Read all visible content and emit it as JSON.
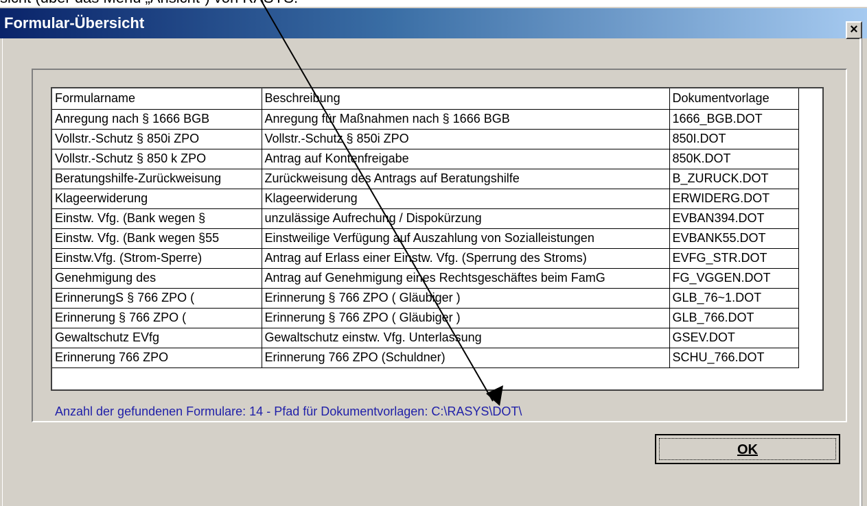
{
  "caption": "sicht (über das Menü „Ansicht“) von RASYS:",
  "window": {
    "title": "Formular-Übersicht",
    "close_label": "×"
  },
  "grid": {
    "columns": [
      "Formularname",
      "Beschreibung",
      "Dokumentvorlage"
    ],
    "rows": [
      [
        "Anregung nach § 1666 BGB",
        "Anregung für Maßnahmen nach § 1666 BGB",
        "1666_BGB.DOT"
      ],
      [
        "Vollstr.-Schutz § 850i ZPO",
        "Vollstr.-Schutz § 850i ZPO",
        "850I.DOT"
      ],
      [
        "Vollstr.-Schutz § 850 k ZPO",
        "Antrag auf Kontenfreigabe",
        "850K.DOT"
      ],
      [
        "Beratungshilfe-Zurückweisung",
        "Zurückweisung des Antrags auf Beratungshilfe",
        "B_ZURUCK.DOT"
      ],
      [
        "Klageerwiderung",
        "Klageerwiderung",
        "ERWIDERG.DOT"
      ],
      [
        "Einstw. Vfg. (Bank wegen §",
        " unzulässige Aufrechung / Dispokürzung",
        "EVBAN394.DOT"
      ],
      [
        "Einstw. Vfg. (Bank wegen §55",
        "Einstweilige Verfügung auf Auszahlung von Sozialleistungen",
        "EVBANK55.DOT"
      ],
      [
        "Einstw.Vfg. (Strom-Sperre)",
        " Antrag auf Erlass einer Einstw. Vfg. (Sperrung des Stroms)",
        "EVFG_STR.DOT"
      ],
      [
        "Genehmigung des",
        "Antrag auf Genehmigung eines Rechtsgeschäftes beim FamG",
        "FG_VGGEN.DOT"
      ],
      [
        "ErinnerungS § 766 ZPO (",
        "Erinnerung § 766 ZPO ( Gläubiger )",
        "GLB_76~1.DOT"
      ],
      [
        "Erinnerung § 766 ZPO (",
        "Erinnerung § 766 ZPO ( Gläubiger )",
        "GLB_766.DOT"
      ],
      [
        "Gewaltschutz EVfg",
        "Gewaltschutz einstw. Vfg. Unterlassung",
        "GSEV.DOT"
      ],
      [
        "Erinnerung 766 ZPO",
        "Erinnerung 766 ZPO (Schuldner)",
        "SCHU_766.DOT"
      ]
    ],
    "scroll_up_icon": "▲",
    "scroll_down_icon": "▼"
  },
  "status": {
    "text": "Anzahl der gefundenen Formulare:  14  -  Pfad für Dokumentvorlagen: C:\\RASYS\\DOT\\"
  },
  "ok_button": {
    "label": "OK"
  },
  "annotation": {
    "color": "#000000"
  }
}
